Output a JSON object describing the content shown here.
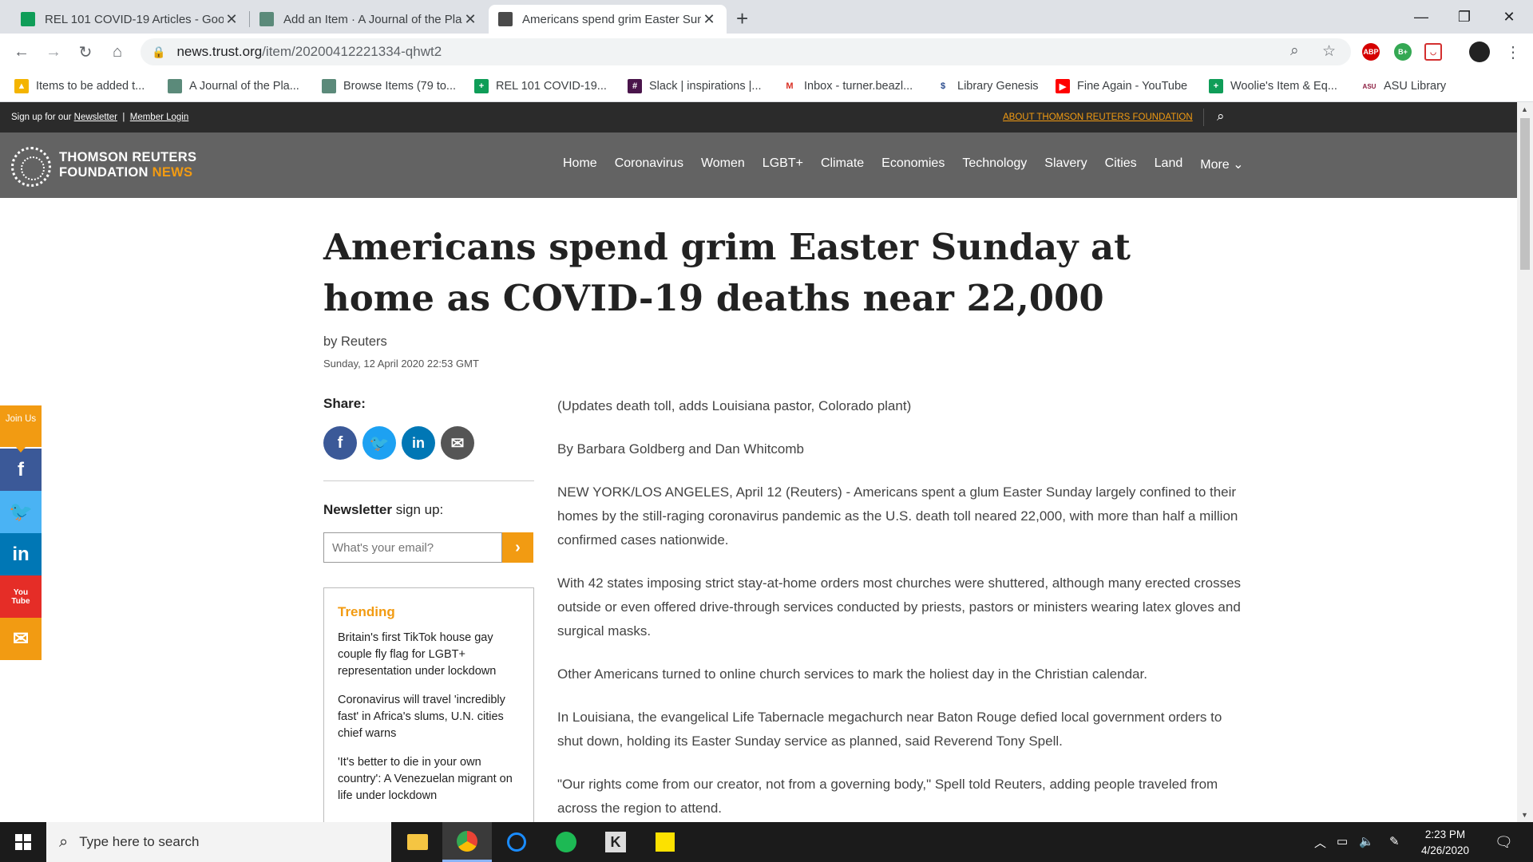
{
  "browser": {
    "tabs": [
      {
        "title": "REL 101 COVID-19 Articles - Goo",
        "favicon": "sheets-icon",
        "color": "#0f9d58"
      },
      {
        "title": "Add an Item · A Journal of the Pla",
        "favicon": "omeka-icon",
        "color": "#5b8a7a"
      },
      {
        "title": "Americans spend grim Easter Sun",
        "favicon": "trf-icon",
        "color": "#4a4a4a"
      }
    ],
    "url_domain": "news.trust.org",
    "url_path": "/item/20200412221334-qhwt2",
    "bookmarks": [
      {
        "label": "Items to be added t...",
        "icon": "drive-icon",
        "color": "#f4b400"
      },
      {
        "label": "A Journal of the Pla...",
        "icon": "omeka-icon",
        "color": "#5b8a7a"
      },
      {
        "label": "Browse Items (79 to...",
        "icon": "omeka-icon",
        "color": "#5b8a7a"
      },
      {
        "label": "REL 101 COVID-19...",
        "icon": "sheets-icon",
        "color": "#0f9d58"
      },
      {
        "label": "Slack | inspirations |...",
        "icon": "slack-icon",
        "color": "#4a154b"
      },
      {
        "label": "Inbox - turner.beazl...",
        "icon": "gmail-icon",
        "color": "#d93025"
      },
      {
        "label": "Library Genesis",
        "icon": "libgen-icon",
        "color": "#2a4b8d"
      },
      {
        "label": "Fine Again - YouTube",
        "icon": "youtube-icon",
        "color": "#ff0000"
      },
      {
        "label": "Woolie's Item & Eq...",
        "icon": "sheets-icon",
        "color": "#0f9d58"
      },
      {
        "label": "ASU Library",
        "icon": "asu-icon",
        "color": "#8c1d40"
      }
    ]
  },
  "site": {
    "topbar_prefix": "Sign up for our",
    "newsletter_link": "Newsletter",
    "member_login": "Member Login",
    "about_link": "ABOUT THOMSON REUTERS FOUNDATION",
    "logo_line1": "THOMSON REUTERS",
    "logo_line2": "FOUNDATION",
    "logo_news": "NEWS",
    "nav": [
      "Home",
      "Coronavirus",
      "Women",
      "LGBT+",
      "Climate",
      "Economies",
      "Technology",
      "Slavery",
      "Cities",
      "Land"
    ],
    "nav_more": "More ⌄",
    "accent": "#f29b12"
  },
  "article": {
    "headline": "Americans spend grim Easter Sunday at home as COVID-19 deaths near 22,000",
    "byline": "by Reuters",
    "date": "Sunday, 12 April 2020 22:53 GMT",
    "paragraphs": [
      "(Updates death toll, adds Louisiana pastor, Colorado plant)",
      "By Barbara Goldberg and Dan Whitcomb",
      "NEW YORK/LOS ANGELES, April 12 (Reuters) - Americans spent a glum Easter Sunday largely confined to their homes by the still-raging coronavirus pandemic as the U.S. death toll neared 22,000, with more than half a million confirmed cases nationwide.",
      "With 42 states imposing strict stay-at-home orders most churches were shuttered, although many erected crosses outside or even offered drive-through services conducted by priests, pastors or ministers wearing latex gloves and surgical masks.",
      "Other Americans turned to online church services to mark the holiest day in the Christian calendar.",
      "In Louisiana, the evangelical Life Tabernacle megachurch near Baton Rouge defied local government orders to shut down, holding its Easter Sunday service as planned, said Reverend Tony Spell.",
      "\"Our rights come from our creator, not from a governing body,\" Spell told Reuters, adding people traveled from across the region to attend."
    ]
  },
  "share": {
    "label": "Share:",
    "buttons": [
      {
        "icon": "facebook-icon",
        "glyph": "f",
        "color": "#3b5998"
      },
      {
        "icon": "twitter-icon",
        "glyph": "t",
        "color": "#1da1f2"
      },
      {
        "icon": "linkedin-icon",
        "glyph": "in",
        "color": "#0077b5"
      },
      {
        "icon": "email-icon",
        "glyph": "✉",
        "color": "#555555"
      }
    ]
  },
  "newsletter": {
    "label_bold": "Newsletter",
    "label_rest": " sign up:",
    "placeholder": "What's your email?",
    "submit": "›"
  },
  "trending": {
    "title": "Trending",
    "items": [
      "Britain's first TikTok house gay couple fly flag for LGBT+ representation under lockdown",
      "Coronavirus will travel 'incredibly fast' in Africa's slums, U.N. cities chief warns",
      "'It's better to die in your own country': A Venezuelan migrant on life under lockdown"
    ]
  },
  "social_sidebar": {
    "join_label": "Join Us",
    "items": [
      {
        "icon": "facebook-icon",
        "glyph": "f",
        "color": "#3b5998"
      },
      {
        "icon": "twitter-icon",
        "glyph": "t",
        "color": "#4ab3f4"
      },
      {
        "icon": "linkedin-icon",
        "glyph": "in",
        "color": "#0077b5"
      },
      {
        "icon": "youtube-icon",
        "glyph": "You Tube",
        "color": "#e52d27"
      },
      {
        "icon": "email-icon",
        "glyph": "✉",
        "color": "#f29b12"
      }
    ]
  },
  "taskbar": {
    "search_placeholder": "Type here to search",
    "time": "2:23 PM",
    "date": "4/26/2020"
  }
}
